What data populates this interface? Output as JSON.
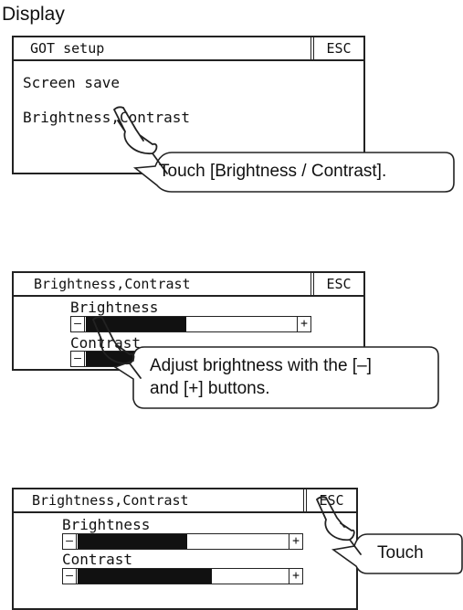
{
  "heading": "Display",
  "screen1": {
    "title": "GOT setup",
    "esc_label": "ESC",
    "items": [
      "Screen save",
      "Brightness,Contrast"
    ],
    "callout": "Touch [Brightness / Contrast]."
  },
  "screen2": {
    "title": "Brightness,Contrast",
    "esc_label": "ESC",
    "brightness_label": "Brightness",
    "contrast_label": "Contrast",
    "minus": "–",
    "plus": "+",
    "brightness_level": 0.48,
    "callout_line1": "Adjust brightness with the [–]",
    "callout_line2": "and [+] buttons."
  },
  "screen3": {
    "title": "Brightness,Contrast",
    "esc_label": "ESC",
    "brightness_label": "Brightness",
    "contrast_label": "Contrast",
    "minus": "–",
    "plus": "+",
    "brightness_level": 0.52,
    "contrast_level": 0.64,
    "callout": "Touch"
  }
}
